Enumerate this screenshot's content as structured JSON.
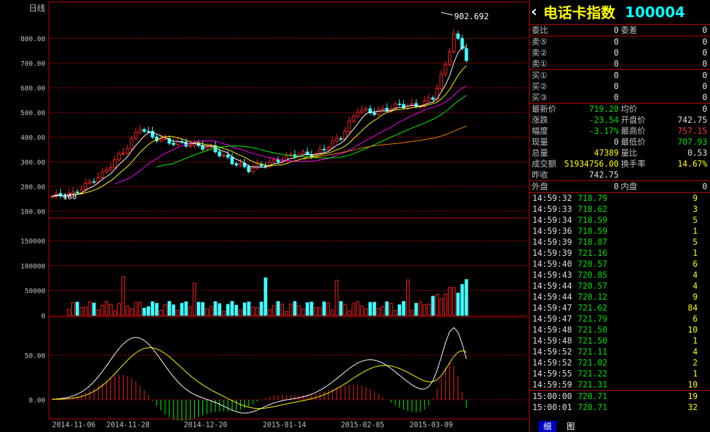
{
  "period_label": "日线",
  "colors": {
    "up": "#ff2020",
    "down": "#40ffff",
    "grid": "#c00000",
    "ma5": "#ffffff",
    "ma10": "#ffff00",
    "ma20": "#ff00ff",
    "ma30": "#00ff00",
    "ma60": "#ff8000"
  },
  "chart_data": [
    {
      "type": "candlestick",
      "ylim": [
        100,
        900
      ],
      "y_ticks": [
        "100.00",
        "200.00",
        "300.00",
        "400.00",
        "500.00",
        "600.00",
        "700.00",
        "800.00"
      ],
      "annotations": [
        {
          "label": "160",
          "note": "low"
        },
        {
          "label": "902.692",
          "note": "high"
        }
      ],
      "grid": true,
      "x_dates": [
        "2014-11-06",
        "2014-11-28",
        "2014-12-20",
        "2015-01-14",
        "2015-02-05",
        "2015-03-09"
      ]
    },
    {
      "type": "bar",
      "ylim": [
        0,
        190000
      ],
      "y_ticks": [
        "0",
        "50000",
        "100000",
        "150000"
      ],
      "grid": true
    },
    {
      "type": "line",
      "ylim": [
        -20,
        90
      ],
      "y_ticks": [
        "0.00",
        "50.00"
      ],
      "grid": true
    }
  ],
  "quote": {
    "name": "电话卡指数",
    "code": "100004",
    "arrow": "‹",
    "weibi_label": "委比",
    "weibi": "0",
    "weicha_label": "委差",
    "weicha": "0",
    "sells": [
      {
        "label": "卖⑤",
        "price": "0",
        "vol": "0"
      },
      {
        "label": "卖②",
        "price": "0",
        "vol": "0"
      },
      {
        "label": "卖①",
        "price": "0",
        "vol": "0"
      }
    ],
    "buys": [
      {
        "label": "买①",
        "price": "0",
        "vol": "0"
      },
      {
        "label": "买②",
        "price": "0",
        "vol": "0"
      },
      {
        "label": "买③",
        "price": "0",
        "vol": "0"
      }
    ],
    "stats": [
      {
        "l1": "最新价",
        "v1": "719.20",
        "c1": "green",
        "l2": "均价",
        "v2": "0",
        "c2": "white"
      },
      {
        "l1": "涨跌",
        "v1": "-23.54",
        "c1": "green",
        "l2": "开盘价",
        "v2": "742.75",
        "c2": "white"
      },
      {
        "l1": "幅度",
        "v1": "-3.17%",
        "c1": "green",
        "l2": "最高价",
        "v2": "757.15",
        "c2": "red"
      },
      {
        "l1": "现量",
        "v1": "0",
        "c1": "white",
        "l2": "最低价",
        "v2": "707.93",
        "c2": "green"
      },
      {
        "l1": "总量",
        "v1": "47389",
        "c1": "yellow",
        "l2": "量比",
        "v2": "0.53",
        "c2": "white"
      },
      {
        "l1": "成交额",
        "v1": "51934756.00",
        "c1": "yellow",
        "l2": "换手率",
        "v2": "14.67%",
        "c2": "yellow"
      },
      {
        "l1": "昨收",
        "v1": "742.75",
        "c1": "white",
        "l2": "",
        "v2": "",
        "c2": "white"
      }
    ],
    "waipan_label": "外盘",
    "waipan": "0",
    "neipan_label": "内盘",
    "neipan": "0"
  },
  "ticks": [
    {
      "time": "14:59:32",
      "price": "718.79",
      "vol": "9"
    },
    {
      "time": "14:59:33",
      "price": "718.62",
      "vol": "3"
    },
    {
      "time": "14:59:34",
      "price": "718.59",
      "vol": "5"
    },
    {
      "time": "14:59:36",
      "price": "718.59",
      "vol": "1"
    },
    {
      "time": "14:59:39",
      "price": "718.87",
      "vol": "5"
    },
    {
      "time": "14:59:39",
      "price": "721.16",
      "vol": "1"
    },
    {
      "time": "14:59:40",
      "price": "720.57",
      "vol": "6"
    },
    {
      "time": "14:59:43",
      "price": "720.85",
      "vol": "4"
    },
    {
      "time": "14:59:44",
      "price": "720.57",
      "vol": "4"
    },
    {
      "time": "14:59:44",
      "price": "720.12",
      "vol": "9"
    },
    {
      "time": "14:59:47",
      "price": "721.62",
      "vol": "84"
    },
    {
      "time": "14:59:47",
      "price": "721.79",
      "vol": "6"
    },
    {
      "time": "14:59:48",
      "price": "721.50",
      "vol": "10"
    },
    {
      "time": "14:59:48",
      "price": "721.50",
      "vol": "1"
    },
    {
      "time": "14:59:52",
      "price": "721.11",
      "vol": "4"
    },
    {
      "time": "14:59:52",
      "price": "721.02",
      "vol": "2"
    },
    {
      "time": "14:59:55",
      "price": "721.22",
      "vol": "1"
    },
    {
      "time": "14:59:59",
      "price": "721.31",
      "vol": "10"
    },
    {
      "time": "15:00:00",
      "price": "720.71",
      "vol": "19"
    },
    {
      "time": "15:00:01",
      "price": "720.71",
      "vol": "32"
    }
  ],
  "tabs": [
    {
      "label": "细",
      "active": true
    },
    {
      "label": "图",
      "active": false
    }
  ]
}
